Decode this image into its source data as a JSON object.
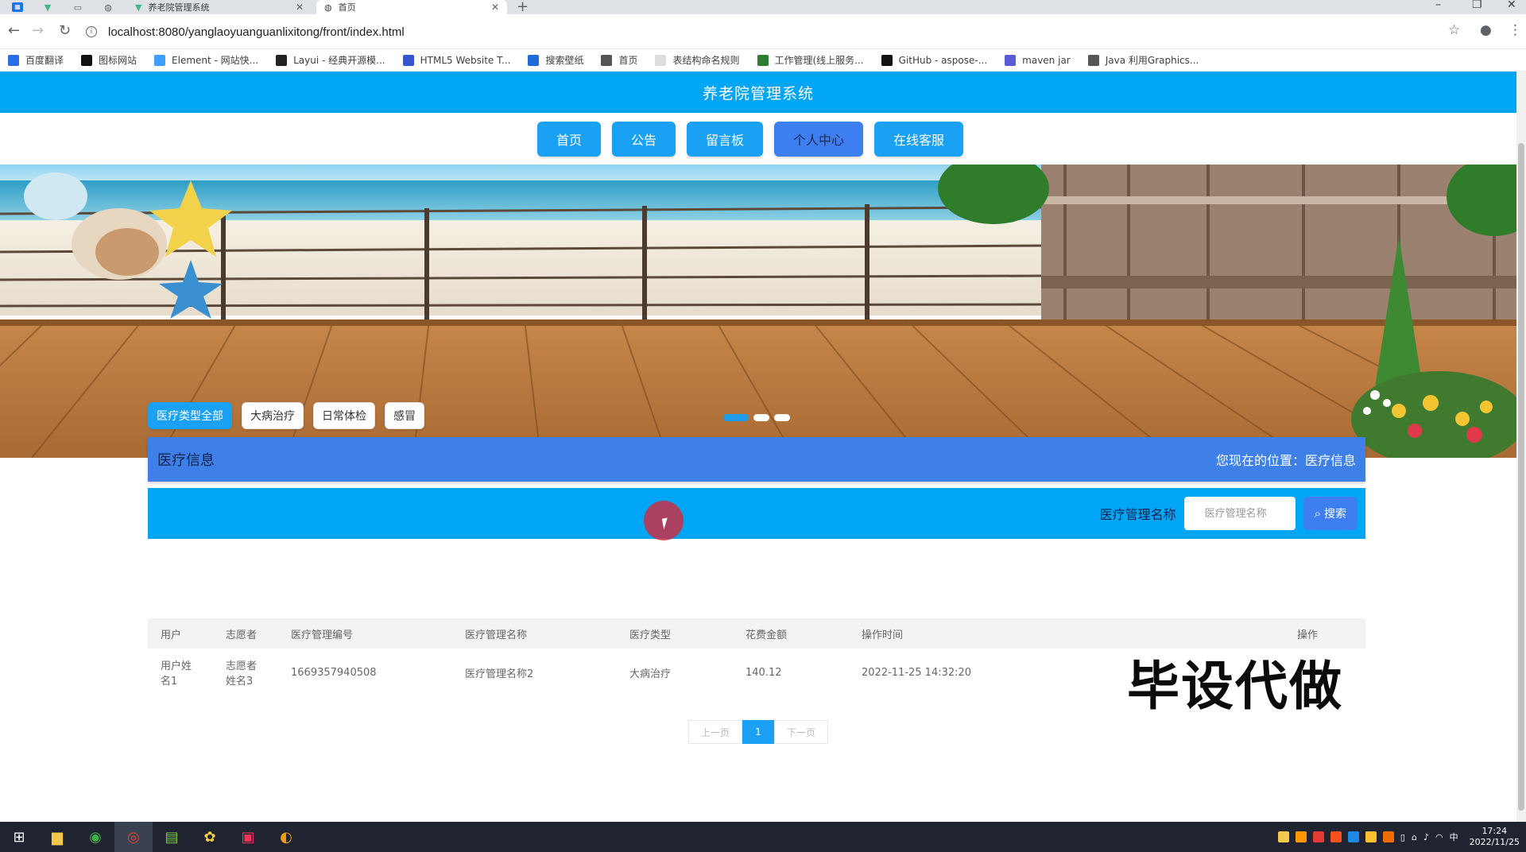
{
  "browser": {
    "tabs": [
      {
        "title": "养老院管理系统",
        "active": false
      },
      {
        "title": "首页",
        "active": true
      }
    ],
    "url": "localhost:8080/yanglaoyuanguanlixitong/front/index.html",
    "bookmarks": [
      {
        "label": "百度翻译",
        "icon": "translate-icon",
        "color": "#2b6de5"
      },
      {
        "label": "图标网站",
        "icon": "icon-site-icon",
        "color": "#111111"
      },
      {
        "label": "Element - 网站快...",
        "icon": "element-icon",
        "color": "#409eff"
      },
      {
        "label": "Layui - 经典开源模...",
        "icon": "layui-icon",
        "color": "#222222"
      },
      {
        "label": "HTML5 Website T...",
        "icon": "html5-icon",
        "color": "#3454d1"
      },
      {
        "label": "搜索壁纸",
        "icon": "wallpaper-icon",
        "color": "#1d6bd8"
      },
      {
        "label": "首页",
        "icon": "globe-icon",
        "color": "#555555"
      },
      {
        "label": "表结构命名规则",
        "icon": "doc-icon",
        "color": "#dddddd"
      },
      {
        "label": "工作管理(线上服务...",
        "icon": "vue-icon",
        "color": "#2e7d32"
      },
      {
        "label": "GitHub - aspose-...",
        "icon": "github-icon",
        "color": "#111111"
      },
      {
        "label": "maven jar",
        "icon": "maven-icon",
        "color": "#5b5bd6"
      },
      {
        "label": "Java 利用Graphics...",
        "icon": "globe-icon",
        "color": "#555555"
      }
    ]
  },
  "site": {
    "title": "养老院管理系统",
    "nav": [
      {
        "label": "首页",
        "active": false
      },
      {
        "label": "公告",
        "active": false
      },
      {
        "label": "留言板",
        "active": false
      },
      {
        "label": "个人中心",
        "active": true
      },
      {
        "label": "在线客服",
        "active": false
      }
    ],
    "carousel": {
      "slides": 3,
      "active_index": 0
    }
  },
  "filters": [
    {
      "label": "医疗类型全部",
      "active": true
    },
    {
      "label": "大病治疗",
      "active": false
    },
    {
      "label": "日常体检",
      "active": false
    },
    {
      "label": "感冒",
      "active": false
    }
  ],
  "section": {
    "title": "医疗信息",
    "breadcrumb": "您现在的位置：医疗信息"
  },
  "search": {
    "label": "医疗管理名称",
    "placeholder": "医疗管理名称",
    "button": "搜索"
  },
  "table": {
    "columns": [
      "用户",
      "志愿者",
      "医疗管理编号",
      "医疗管理名称",
      "医疗类型",
      "花费金额",
      "操作时间",
      "操作"
    ],
    "rows": [
      [
        "用户姓名1",
        "志愿者姓名3",
        "1669357940508",
        "医疗管理名称2",
        "大病治疗",
        "140.12",
        "2022-11-25 14:32:20",
        ""
      ]
    ]
  },
  "pager": {
    "prev": "上一页",
    "current": "1",
    "next": "下一页"
  },
  "watermark": "毕设代做",
  "taskbar": {
    "time": "17:24",
    "date": "2022/11/25",
    "ime": "中"
  },
  "colors": {
    "header": "#00a6f5",
    "section_bar": "#3f7fe8",
    "nav_button": "#1aa1f3"
  }
}
